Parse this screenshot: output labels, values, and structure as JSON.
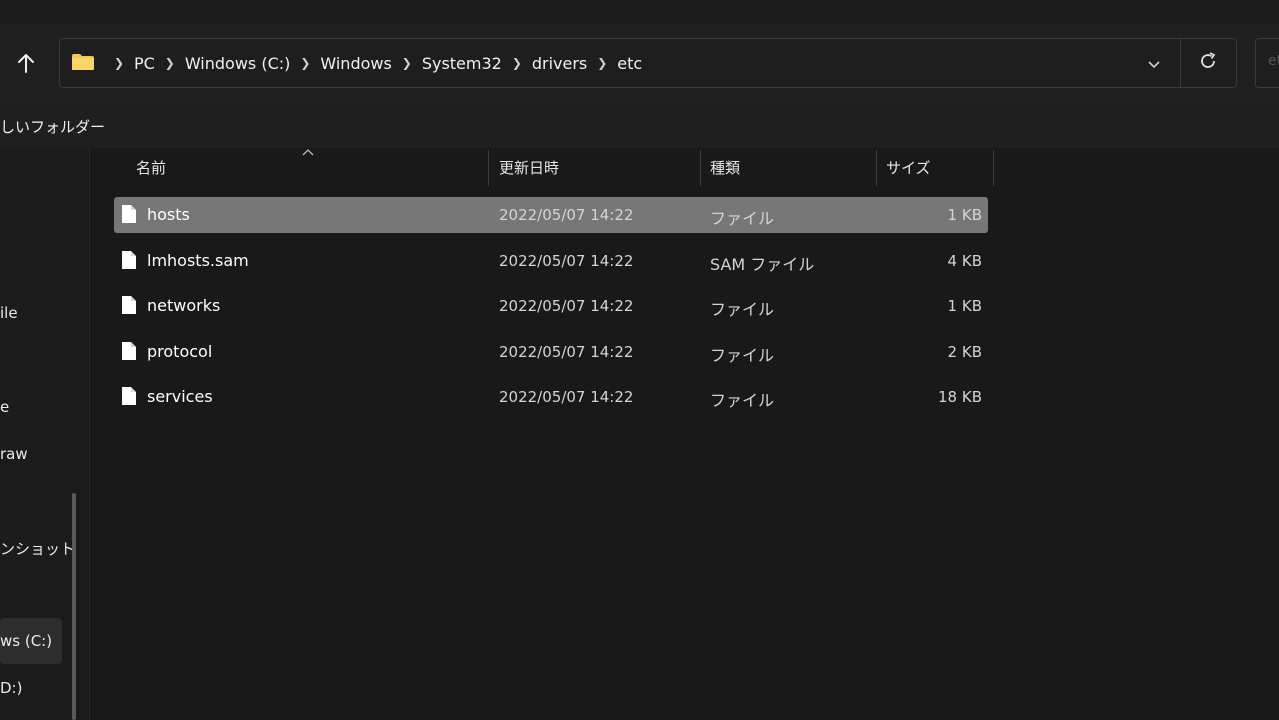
{
  "address": {
    "crumbs": [
      "PC",
      "Windows (C:)",
      "Windows",
      "System32",
      "drivers",
      "etc"
    ]
  },
  "search": {
    "placeholder": "et"
  },
  "toolbar": {
    "new_folder_label": "しいフォルダー"
  },
  "sidebar": {
    "items": [
      {
        "label": "ile"
      },
      {
        "label": "e"
      },
      {
        "label": "raw"
      },
      {
        "label": "ンショット"
      },
      {
        "label": "ws (C:)"
      },
      {
        "label": "D:)"
      }
    ]
  },
  "columns": {
    "name": "名前",
    "date": "更新日時",
    "type": "種類",
    "size": "サイズ"
  },
  "files": [
    {
      "name": "hosts",
      "date": "2022/05/07 14:22",
      "type": "ファイル",
      "size": "1 KB",
      "selected": true
    },
    {
      "name": "lmhosts.sam",
      "date": "2022/05/07 14:22",
      "type": "SAM ファイル",
      "size": "4 KB",
      "selected": false
    },
    {
      "name": "networks",
      "date": "2022/05/07 14:22",
      "type": "ファイル",
      "size": "1 KB",
      "selected": false
    },
    {
      "name": "protocol",
      "date": "2022/05/07 14:22",
      "type": "ファイル",
      "size": "2 KB",
      "selected": false
    },
    {
      "name": "services",
      "date": "2022/05/07 14:22",
      "type": "ファイル",
      "size": "18 KB",
      "selected": false
    }
  ],
  "icons": {
    "up": "arrow-up-icon",
    "folder": "folder-icon",
    "chevron": "chevron-right-icon",
    "dropdown": "chevron-down-icon",
    "refresh": "refresh-icon",
    "file": "file-icon",
    "sort": "sort-ascending-icon"
  },
  "colors": {
    "background": "#191919",
    "selected_row": "#777777",
    "folder": "#f2c94c"
  }
}
